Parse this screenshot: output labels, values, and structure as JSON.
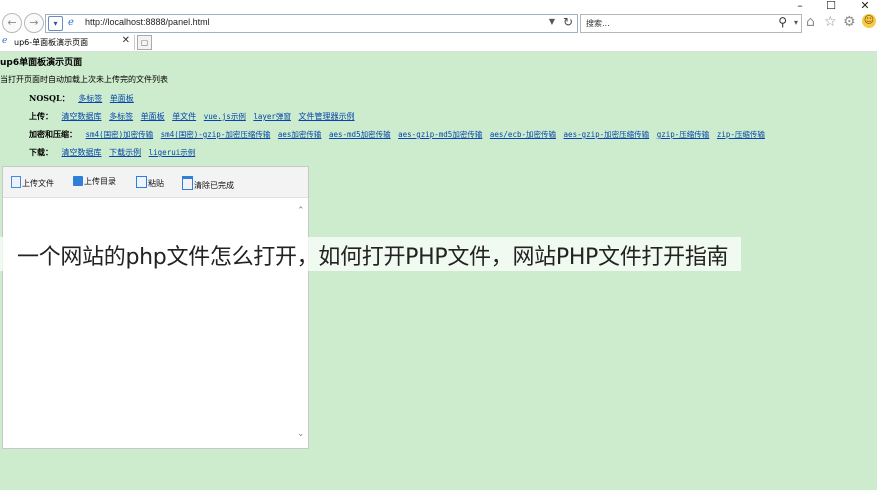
{
  "browser": {
    "window_controls": {
      "minimize": "–",
      "maximize": "☐",
      "close": "✕"
    },
    "url": "http://localhost:8888/panel.html",
    "search_placeholder": "搜索...",
    "tab_title": "up6-单面板演示页面"
  },
  "page": {
    "title": "up6单面板演示页面",
    "description": "当打开页面时自动加载上次未上传完的文件列表",
    "rows": [
      {
        "label": "NOSQL：",
        "links": [
          "多标签",
          "单面板"
        ]
      },
      {
        "label": "上传：",
        "links": [
          "清空数据库",
          "多标签",
          "单面板",
          "单文件",
          "vue.js示例",
          "layer弹窗",
          "文件管理器示例"
        ]
      },
      {
        "label": "加密和压缩：",
        "links": [
          "sm4(国密)加密传输",
          "sm4(国密)-gzip-加密压缩传输",
          "aes加密传输",
          "aes-md5加密传输",
          "aes-gzip-md5加密传输",
          "aes/ecb-加密传输",
          "aes-gzip-加密压缩传输",
          "gzip-压缩传输",
          "zip-压缩传输"
        ]
      },
      {
        "label": "下载：",
        "links": [
          "清空数据库",
          "下载示例",
          "ligerui示例"
        ]
      }
    ]
  },
  "uploader": {
    "toolbar": {
      "upload_file": "上传文件",
      "upload_folder": "上传目录",
      "paste": "粘贴",
      "clear_done": "清除已完成"
    }
  },
  "overlay": {
    "caption": "一个网站的php文件怎么打开，如何打开PHP文件，网站PHP文件打开指南"
  }
}
